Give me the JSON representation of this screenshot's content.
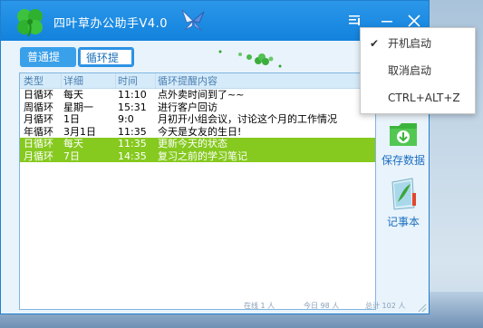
{
  "app": {
    "title": "四叶草办公助手V4.0"
  },
  "tabs": [
    {
      "label": "普通提醒",
      "active": false
    },
    {
      "label": "循环提醒",
      "active": true
    }
  ],
  "table": {
    "headers": [
      "类型",
      "详细",
      "时间",
      "循环提醒内容"
    ],
    "rows": [
      {
        "type": "日循环",
        "detail": "每天",
        "time": "11:10",
        "content": "点外卖时间到了~~",
        "highlighted": false
      },
      {
        "type": "周循环",
        "detail": "星期一",
        "time": "15:31",
        "content": "进行客户回访",
        "highlighted": false
      },
      {
        "type": "月循环",
        "detail": "1日",
        "time": "9:0",
        "content": "月初开小组会议，讨论这个月的工作情况",
        "highlighted": false
      },
      {
        "type": "年循环",
        "detail": "3月1日",
        "time": "11:35",
        "content": "今天是女友的生日!",
        "highlighted": false
      },
      {
        "type": "日循环",
        "detail": "每天",
        "time": "11:35",
        "content": "更新今天的状态",
        "highlighted": true
      },
      {
        "type": "月循环",
        "detail": "7日",
        "time": "14:35",
        "content": "复习之前的学习笔记",
        "highlighted": true
      }
    ]
  },
  "sidebar": {
    "save_label": "保存数据",
    "note_label": "记事本"
  },
  "status": {
    "online": "在线 1 人",
    "today": "今日 98 人",
    "total": "总计 102 人"
  },
  "menu": {
    "items": [
      {
        "label": "开机启动",
        "checked": true
      },
      {
        "label": "取消启动",
        "checked": false
      },
      {
        "label": "CTRL+ALT+Z",
        "checked": false
      }
    ]
  },
  "colors": {
    "titlebar": "#1282dc",
    "highlight_row": "#86c91f",
    "header_bg": "#d6ebfa"
  }
}
